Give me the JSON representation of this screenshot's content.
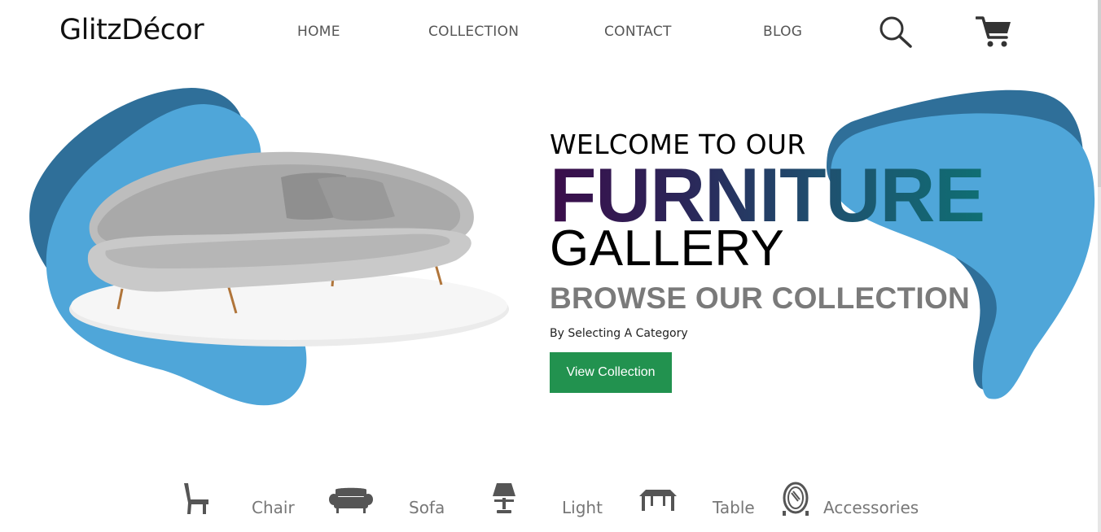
{
  "brand": {
    "name": "GlitzDécor"
  },
  "nav": {
    "items": [
      {
        "label": "HOME"
      },
      {
        "label": "COLLECTION"
      },
      {
        "label": "CONTACT"
      },
      {
        "label": "BLOG"
      }
    ],
    "icons": [
      "search-icon",
      "cart-icon"
    ]
  },
  "hero": {
    "line1": "WELCOME TO OUR",
    "line2": "FURNITURE",
    "line3": "GALLERY",
    "subheading": "BROWSE OUR COLLECTION",
    "caption": "By Selecting A Category",
    "cta_label": "View Collection",
    "image": "curved-sofa"
  },
  "categories": [
    {
      "label": "Chair",
      "icon": "chair-icon"
    },
    {
      "label": "Sofa",
      "icon": "sofa-icon"
    },
    {
      "label": "Light",
      "icon": "lamp-icon"
    },
    {
      "label": "Table",
      "icon": "table-icon"
    },
    {
      "label": "Accessories",
      "icon": "mirror-icon"
    }
  ],
  "colors": {
    "blob_light": "#4fa6d9",
    "blob_dark": "#2f6f99",
    "cta": "#22924f",
    "heading_gradient": [
      "#3b0d4a",
      "#0f6f73"
    ],
    "browse": "#7a7a7a",
    "muted": "#777777"
  }
}
